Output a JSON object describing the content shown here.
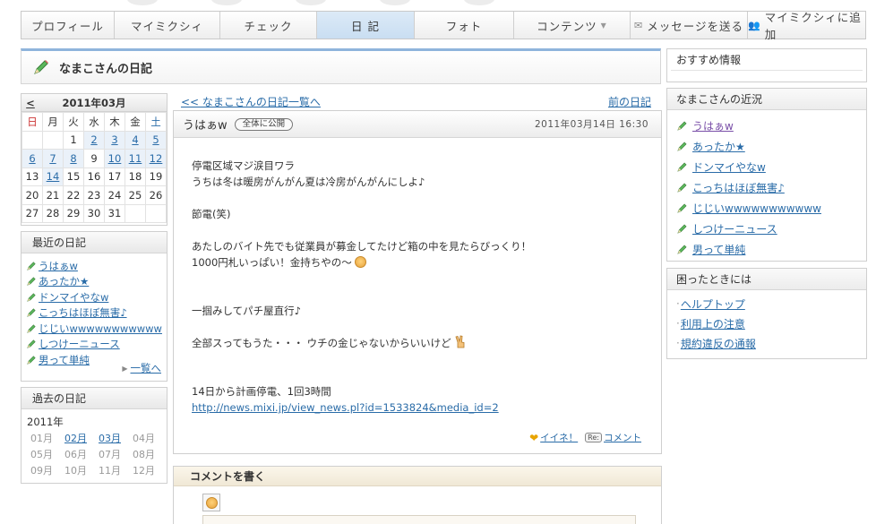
{
  "nav": {
    "tabs": [
      {
        "label": "プロフィール"
      },
      {
        "label": "マイミクシィ"
      },
      {
        "label": "チェック"
      },
      {
        "label": "日 記"
      },
      {
        "label": "フォト"
      },
      {
        "label": "コンテンツ"
      },
      {
        "label": "メッセージを送る"
      },
      {
        "label": "マイミクシィに追加"
      }
    ]
  },
  "page": {
    "title": "なまこさんの日記"
  },
  "calendar": {
    "month": "2011年03月",
    "weekdays": [
      "日",
      "月",
      "火",
      "水",
      "木",
      "金",
      "土"
    ],
    "rows": [
      [
        "",
        "",
        "1",
        "2",
        "3",
        "4",
        "5"
      ],
      [
        "6",
        "7",
        "8",
        "9",
        "10",
        "11",
        "12"
      ],
      [
        "13",
        "14",
        "15",
        "16",
        "17",
        "18",
        "19"
      ],
      [
        "20",
        "21",
        "22",
        "23",
        "24",
        "25",
        "26"
      ],
      [
        "27",
        "28",
        "29",
        "30",
        "31",
        "",
        ""
      ]
    ]
  },
  "recent": {
    "title": "最近の日記",
    "items": [
      "うはぁw",
      "あったか★",
      "ドンマイやなw",
      "こっちはほぼ無害♪",
      "じじいwwwwwwwwwww",
      "しつけーニュース",
      "男って単純"
    ],
    "more": "一覧へ"
  },
  "past": {
    "title": "過去の日記",
    "year": "2011年",
    "months": [
      "01月",
      "02月",
      "03月",
      "04月",
      "05月",
      "06月",
      "07月",
      "08月",
      "09月",
      "10月",
      "11月",
      "12月"
    ]
  },
  "main": {
    "back_link": "<< なまこさんの日記一覧へ",
    "prev_link": "前の日記"
  },
  "entry": {
    "title": "うはぁw",
    "visibility": "全体に公開",
    "date": "2011年03月14日 16:30",
    "lines": {
      "l1": "停電区域マジ涙目ワラ",
      "l2": "うちは冬は暖房がんがん夏は冷房がんがんにしよ♪",
      "l3": "節電(笑)",
      "l4": "あたしのバイト先でも従業員が募金してたけど箱の中を見たらびっくり！",
      "l5": "1000円札いっぱい！金持ちやの〜",
      "l6": "一掴みしてパチ屋直行♪",
      "l7": "全部スってもうた・・・ ウチの金じゃないからいいけど",
      "l8": "14日から計画停電、1回3時間",
      "link": "http://news.mixi.jp/view_news.pl?id=1533824&media_id=2"
    },
    "like": "イイネ！",
    "comment": "コメント",
    "re": "Re:"
  },
  "comment_box": {
    "title": "コメントを書く"
  },
  "right": {
    "reco_title": "おすすめ情報",
    "status_title": "なまこさんの近況",
    "status_items": [
      "うはぁw",
      "あったか★",
      "ドンマイやなw",
      "こっちはほぼ無害♪",
      "じじいwwwwwwwwwww",
      "しつけーニュース",
      "男って単純"
    ],
    "help_title": "困ったときには",
    "help_items": [
      "ヘルプトップ",
      "利用上の注意",
      "規約違反の通報"
    ]
  },
  "colors": {
    "accent": "#8fb4dc",
    "link": "#2a6ca8",
    "active_tab": "#c9def2"
  }
}
